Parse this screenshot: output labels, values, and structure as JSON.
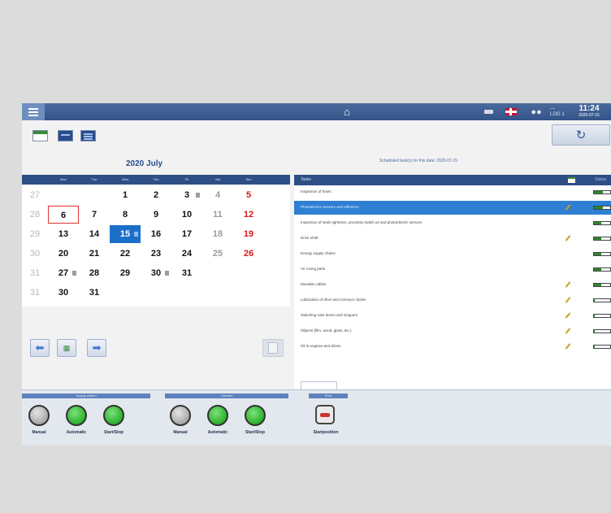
{
  "topbar": {
    "menu_icon": "hamburger-menu-icon",
    "home_icon": "home-icon",
    "language_flag": "uk-flag-icon",
    "users_icon": "users-icon",
    "level_text": "—\nLOG 1",
    "time": "11:24",
    "date": "2020-07-15"
  },
  "calendar": {
    "title": "2020 July",
    "weekdays": [
      "Mon",
      "Tue",
      "Wed",
      "Thu",
      "Fri",
      "Sat",
      "Sun"
    ],
    "weeks": [
      {
        "num": "27",
        "days": [
          "",
          "",
          "1",
          "2",
          "3",
          "4",
          "5"
        ]
      },
      {
        "num": "28",
        "days": [
          "6",
          "7",
          "8",
          "9",
          "10",
          "11",
          "12"
        ]
      },
      {
        "num": "29",
        "days": [
          "13",
          "14",
          "15",
          "16",
          "17",
          "18",
          "19"
        ]
      },
      {
        "num": "30",
        "days": [
          "20",
          "21",
          "22",
          "23",
          "24",
          "25",
          "26"
        ]
      },
      {
        "num": "31",
        "days": [
          "27",
          "28",
          "29",
          "30",
          "31",
          "",
          ""
        ]
      },
      {
        "num": "31",
        "days": [
          "30",
          "31",
          "",
          "",
          "",
          "",
          ""
        ]
      }
    ],
    "today": "6",
    "selected": "15",
    "weekend_color": "#d61a1a",
    "selection_color": "#1c6fc9"
  },
  "tasks": {
    "caption": "Scheduled task(s) for this date: 2020-07-15",
    "header_label": "Tasks",
    "header_right": "Status",
    "items": [
      {
        "name": "Inspection of fuses",
        "edit": false,
        "progress": 0.55
      },
      {
        "name": "Photoelectric sensors and reflectors",
        "edit": true,
        "progress": 0.55
      },
      {
        "name": "Inspection of seals tightness, proximity switch as and photoelectric sensors",
        "edit": false,
        "progress": 0.45
      },
      {
        "name": "Drive shaft",
        "edit": true,
        "progress": 0.45
      },
      {
        "name": "Energy supply chains",
        "edit": false,
        "progress": 0.45
      },
      {
        "name": "Air roving parts",
        "edit": false,
        "progress": 0.45
      },
      {
        "name": "Movable cables",
        "edit": true,
        "progress": 0.45
      },
      {
        "name": "Lubrication of drive and conveyor chains",
        "edit": true,
        "progress": 0.05
      },
      {
        "name": "Switching ruler levers and stoppers",
        "edit": true,
        "progress": 0.05
      },
      {
        "name": "Objects (film, wood, glass, etc.)",
        "edit": true,
        "progress": 0.05
      },
      {
        "name": "Oil in engines and drives",
        "edit": true,
        "progress": 0.05
      }
    ],
    "panel_tab": "",
    "progress_color": "#2a8a2a"
  },
  "controls": {
    "groups": [
      {
        "label": "Supply station",
        "items": [
          {
            "label": "Manual",
            "state": "off"
          },
          {
            "label": "Automatic",
            "state": "on"
          },
          {
            "label": "Start/Stop",
            "state": "on"
          }
        ]
      },
      {
        "label": "Transfer",
        "items": [
          {
            "label": "Manual",
            "state": "off"
          },
          {
            "label": "Automatic",
            "state": "on"
          },
          {
            "label": "Start/Stop",
            "state": "on"
          }
        ]
      },
      {
        "label": "Print",
        "items": [
          {
            "label": "Startposition",
            "state": "button"
          }
        ]
      }
    ]
  }
}
